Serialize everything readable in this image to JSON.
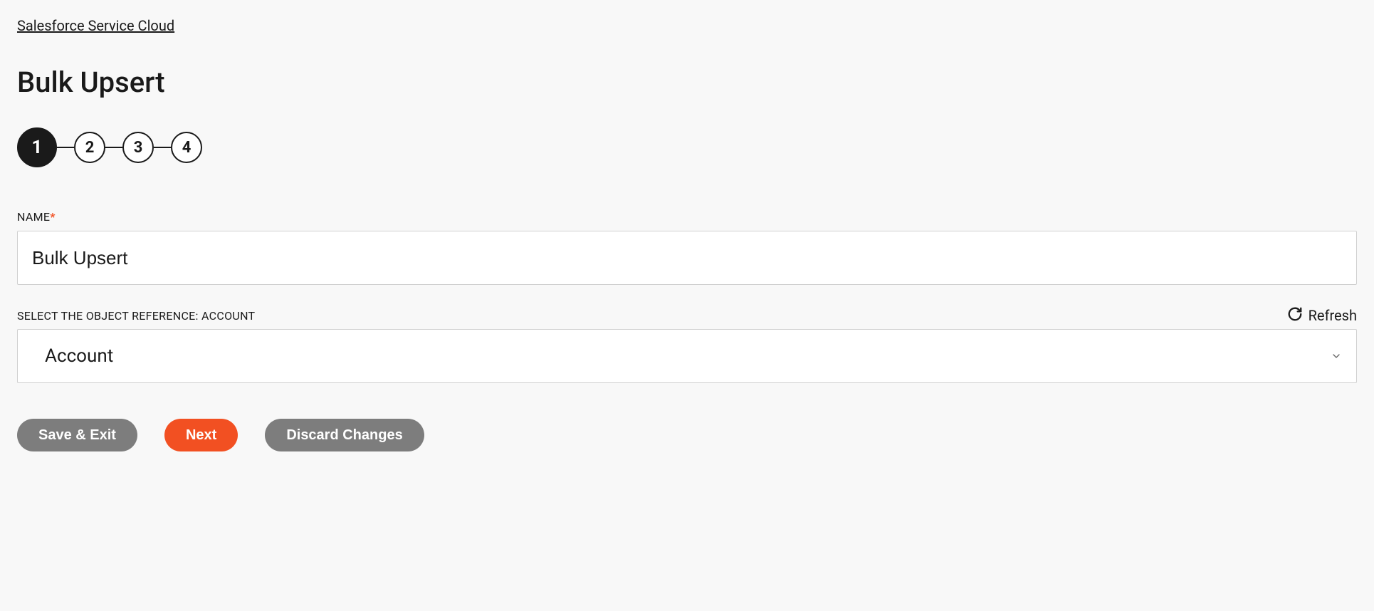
{
  "breadcrumb": {
    "label": "Salesforce Service Cloud"
  },
  "header": {
    "title": "Bulk Upsert"
  },
  "stepper": {
    "current": 1,
    "steps": [
      "1",
      "2",
      "3",
      "4"
    ]
  },
  "form": {
    "name_field": {
      "label": "NAME",
      "required_mark": "*",
      "value": "Bulk Upsert"
    },
    "object_ref_field": {
      "label": "SELECT THE OBJECT REFERENCE: ACCOUNT",
      "selected": "Account",
      "refresh_label": "Refresh"
    }
  },
  "buttons": {
    "save_exit": "Save & Exit",
    "next": "Next",
    "discard": "Discard Changes"
  }
}
